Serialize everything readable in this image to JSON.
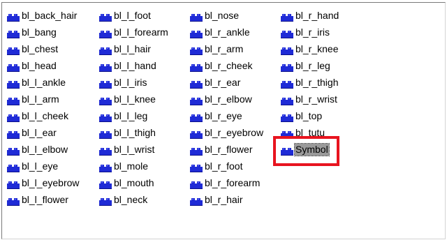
{
  "library": {
    "columns": [
      [
        "bl_back_hair",
        "bl_bang",
        "bl_chest",
        "bl_head",
        "bl_l_ankle",
        "bl_l_arm",
        "bl_l_cheek",
        "bl_l_ear",
        "bl_l_elbow",
        "bl_l_eye",
        "bl_l_eyebrow",
        "bl_l_flower"
      ],
      [
        "bl_l_foot",
        "bl_l_forearm",
        "bl_l_hair",
        "bl_l_hand",
        "bl_l_iris",
        "bl_l_knee",
        "bl_l_leg",
        "bl_l_thigh",
        "bl_l_wrist",
        "bl_mole",
        "bl_mouth",
        "bl_neck"
      ],
      [
        "bl_nose",
        "bl_r_ankle",
        "bl_r_arm",
        "bl_r_cheek",
        "bl_r_ear",
        "bl_r_elbow",
        "bl_r_eye",
        "bl_r_eyebrow",
        "bl_r_flower",
        "bl_r_foot",
        "bl_r_forearm",
        "bl_r_hair"
      ],
      [
        "bl_r_hand",
        "bl_r_iris",
        "bl_r_knee",
        "bl_r_leg",
        "bl_r_thigh",
        "bl_r_wrist",
        "bl_top",
        "bl_tutu",
        "Symbol"
      ]
    ],
    "selected": "Symbol",
    "item_icon": "symbol-blocks-icon"
  },
  "colors": {
    "icon_blue": "#1f2bd6",
    "icon_dark": "#0b0f8a",
    "selection_bg": "#9a9a9a",
    "highlight_red": "#e8141f"
  }
}
